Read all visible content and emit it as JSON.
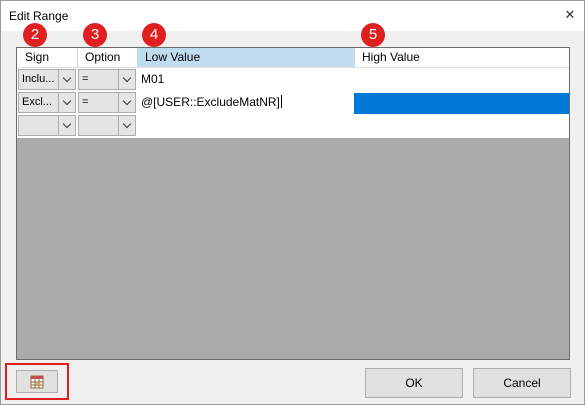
{
  "window": {
    "title": "Edit Range",
    "close_glyph": "✕"
  },
  "grid": {
    "columns": [
      {
        "label": "Sign",
        "badge": "2"
      },
      {
        "label": "Option",
        "badge": "3"
      },
      {
        "label": "Low Value",
        "badge": "4"
      },
      {
        "label": "High Value",
        "badge": "5"
      }
    ],
    "rows": [
      {
        "sign": "Inclu...",
        "option": "=",
        "low": "M01",
        "high": ""
      },
      {
        "sign": "Excl...",
        "option": "=",
        "low": "@[USER::ExcludeMatNR]",
        "high": "",
        "high_selected": true
      },
      {
        "sign": "",
        "option": "",
        "low": "",
        "high": ""
      }
    ]
  },
  "footer": {
    "picker_icon": "table-select-icon",
    "ok_label": "OK",
    "cancel_label": "Cancel"
  },
  "colors": {
    "badge": "#e02020",
    "selection": "#0078d7",
    "header_selected": "#bfdcf1"
  }
}
